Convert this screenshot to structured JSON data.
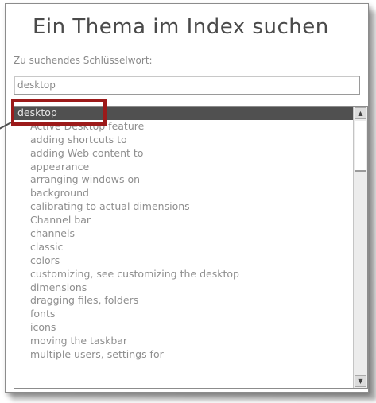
{
  "dialog": {
    "title": "Ein Thema im Index suchen",
    "search_label": "Zu suchendes Schlüsselwort:",
    "search_value": "desktop"
  },
  "colors": {
    "selection_bg": "#505050",
    "highlight_frame": "#9c1a1a"
  },
  "index_list": {
    "items": [
      {
        "label": "desktop",
        "selected": true,
        "indent": false
      },
      {
        "label": "Active Desktop feature",
        "selected": false,
        "indent": true
      },
      {
        "label": "adding shortcuts to",
        "selected": false,
        "indent": true
      },
      {
        "label": "adding Web content to",
        "selected": false,
        "indent": true
      },
      {
        "label": "appearance",
        "selected": false,
        "indent": true
      },
      {
        "label": "arranging windows on",
        "selected": false,
        "indent": true
      },
      {
        "label": "background",
        "selected": false,
        "indent": true
      },
      {
        "label": "calibrating to actual dimensions",
        "selected": false,
        "indent": true
      },
      {
        "label": "Channel bar",
        "selected": false,
        "indent": true
      },
      {
        "label": "channels",
        "selected": false,
        "indent": true
      },
      {
        "label": "classic",
        "selected": false,
        "indent": true
      },
      {
        "label": "colors",
        "selected": false,
        "indent": true
      },
      {
        "label": "customizing, see customizing the desktop",
        "selected": false,
        "indent": true
      },
      {
        "label": "dimensions",
        "selected": false,
        "indent": true
      },
      {
        "label": "dragging files, folders",
        "selected": false,
        "indent": true
      },
      {
        "label": "fonts",
        "selected": false,
        "indent": true
      },
      {
        "label": "icons",
        "selected": false,
        "indent": true
      },
      {
        "label": "moving the taskbar",
        "selected": false,
        "indent": true
      },
      {
        "label": "multiple users, settings for",
        "selected": false,
        "indent": true
      }
    ]
  },
  "scrollbar": {
    "up_icon": "arrow-up-icon",
    "down_icon": "arrow-down-icon",
    "up_glyph": "▲",
    "down_glyph": "▼"
  }
}
